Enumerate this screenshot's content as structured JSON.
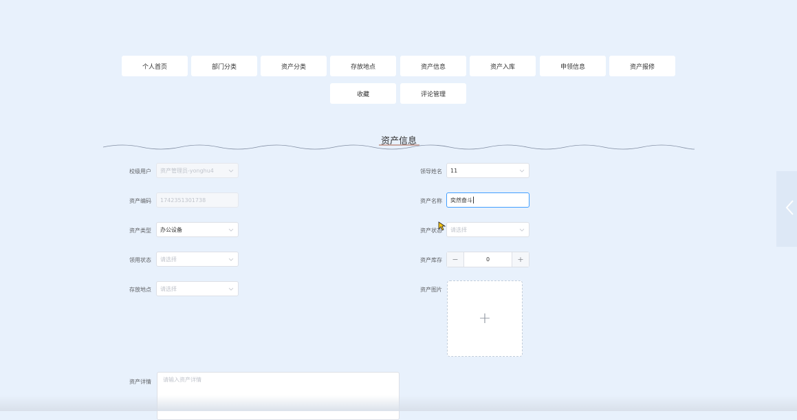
{
  "nav": {
    "row1": [
      "个人首页",
      "部门分类",
      "资产分类",
      "存放地点",
      "资产信息",
      "资产入库",
      "申领信息",
      "资产报修"
    ],
    "row2": [
      "收藏",
      "评论管理"
    ]
  },
  "page_title": "资产信息",
  "form": {
    "school_user": {
      "label": "校级用户",
      "value": "资产管理员-yonghu4"
    },
    "leader_name": {
      "label": "领导姓名",
      "value": "11"
    },
    "asset_code": {
      "label": "资产编码",
      "value": "1742351301738"
    },
    "asset_name": {
      "label": "资产名称",
      "value": "奕然奋斗"
    },
    "asset_type": {
      "label": "资产类型",
      "value": "办公设备"
    },
    "asset_status": {
      "label": "资产状态",
      "placeholder": "请选择"
    },
    "use_status": {
      "label": "领用状态",
      "placeholder": "请选择"
    },
    "asset_stock": {
      "label": "资产库存",
      "value": "0",
      "minus": "−",
      "plus": "+"
    },
    "location": {
      "label": "存放地点",
      "placeholder": "请选择"
    },
    "asset_image": {
      "label": "资产图片",
      "plus": "+"
    },
    "asset_detail": {
      "label": "资产详情",
      "placeholder": "请输入资产详情"
    }
  },
  "colors": {
    "background": "#e8f1fc",
    "focus": "#409eff"
  }
}
